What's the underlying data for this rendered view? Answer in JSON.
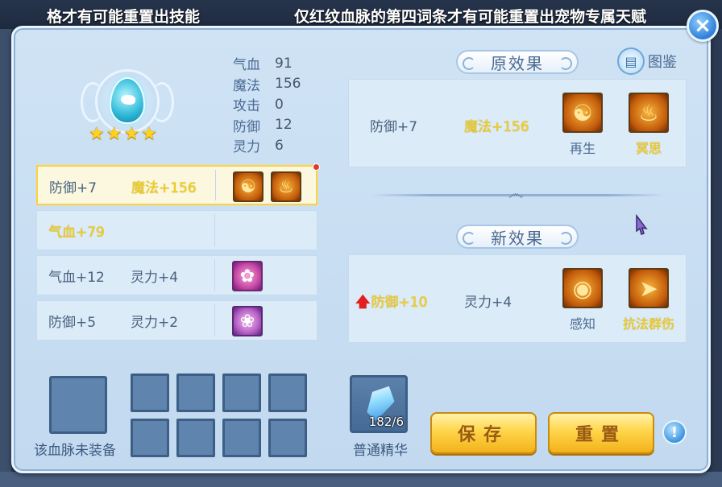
{
  "banner": {
    "left_text": "格才有可能重置出技能",
    "right_text": "仅红纹血脉的第四词条才有可能重置出宠物专属天赋"
  },
  "stats": [
    {
      "label": "气血",
      "value": "91"
    },
    {
      "label": "魔法",
      "value": "156"
    },
    {
      "label": "攻击",
      "value": "0"
    },
    {
      "label": "防御",
      "value": "12"
    },
    {
      "label": "灵力",
      "value": "6"
    }
  ],
  "rating_stars": 4,
  "entries": [
    {
      "attr1": "防御+7",
      "attr2": "魔法+156",
      "selected": true
    },
    {
      "attr1": "气血+79",
      "attr2": "",
      "selected": false
    },
    {
      "attr1": "气血+12",
      "attr2": "灵力+4",
      "selected": false
    },
    {
      "attr1": "防御+5",
      "attr2": "灵力+2",
      "selected": false
    }
  ],
  "original": {
    "title": "原效果",
    "attr1": "防御+7",
    "attr2": "魔法+156",
    "skills": [
      {
        "name": "再生",
        "icon": "regen-skill-icon"
      },
      {
        "name": "冥思",
        "icon": "meditation-skill-icon"
      }
    ]
  },
  "new": {
    "title": "新效果",
    "attr1": "防御+10",
    "attr2": "灵力+4",
    "skills": [
      {
        "name": "感知",
        "icon": "perception-skill-icon"
      },
      {
        "name": "抗法群伤",
        "icon": "magic-resist-aoe-skill-icon"
      }
    ]
  },
  "atlas_label": "图鉴",
  "bloodline_slot_caption": "该血脉未装备",
  "essence": {
    "count": "182/6",
    "caption": "普通精华"
  },
  "buttons": {
    "save": "保存",
    "reset": "重置"
  },
  "colors": {
    "highlight_yellow": "#f7d117",
    "accent_blue": "#4b6a91",
    "up_arrow": "#e21e1e"
  }
}
